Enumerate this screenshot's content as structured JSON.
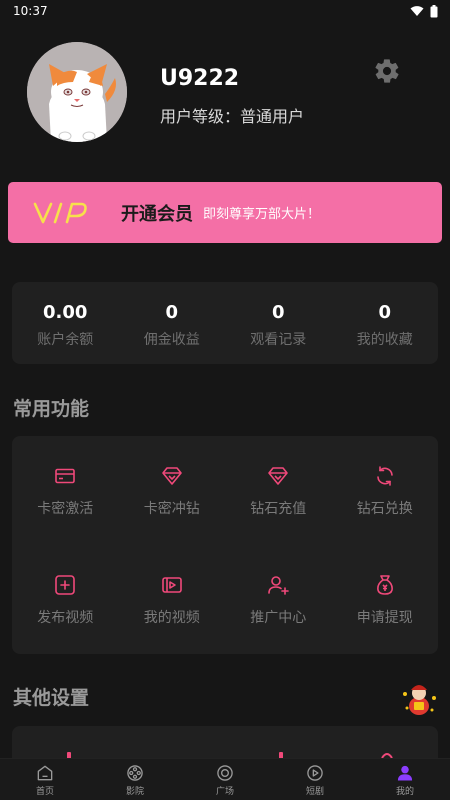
{
  "status_bar": {
    "time": "10:37"
  },
  "profile": {
    "username": "U9222",
    "level_label": "用户等级：普通用户"
  },
  "vip": {
    "logo_text": "VIP",
    "title": "开通会员",
    "subtitle": "即刻尊享万部大片！"
  },
  "stats": [
    {
      "value": "0.00",
      "label": "账户余额"
    },
    {
      "value": "0",
      "label": "佣金收益"
    },
    {
      "value": "0",
      "label": "观看记录"
    },
    {
      "value": "0",
      "label": "我的收藏"
    }
  ],
  "sections": {
    "common": "常用功能",
    "other": "其他设置"
  },
  "functions": [
    {
      "label": "卡密激活",
      "icon": "card-icon"
    },
    {
      "label": "卡密冲钻",
      "icon": "diamond-icon"
    },
    {
      "label": "钻石充值",
      "icon": "diamond-icon"
    },
    {
      "label": "钻石兑换",
      "icon": "exchange-icon"
    },
    {
      "label": "发布视频",
      "icon": "add-video-icon"
    },
    {
      "label": "我的视频",
      "icon": "video-icon"
    },
    {
      "label": "推广中心",
      "icon": "add-user-icon"
    },
    {
      "label": "申请提现",
      "icon": "money-bag-icon"
    }
  ],
  "tabs": [
    {
      "label": "首页",
      "icon": "home-icon"
    },
    {
      "label": "影院",
      "icon": "film-reel-icon"
    },
    {
      "label": "广场",
      "icon": "circle-icon"
    },
    {
      "label": "短剧",
      "icon": "play-icon"
    },
    {
      "label": "我的",
      "icon": "user-icon",
      "active": true
    }
  ],
  "colors": {
    "accent": "#f46fa6",
    "icon_pink": "#f0497a",
    "active_tab": "#8b3dff",
    "background": "#161616",
    "card": "#202020"
  }
}
